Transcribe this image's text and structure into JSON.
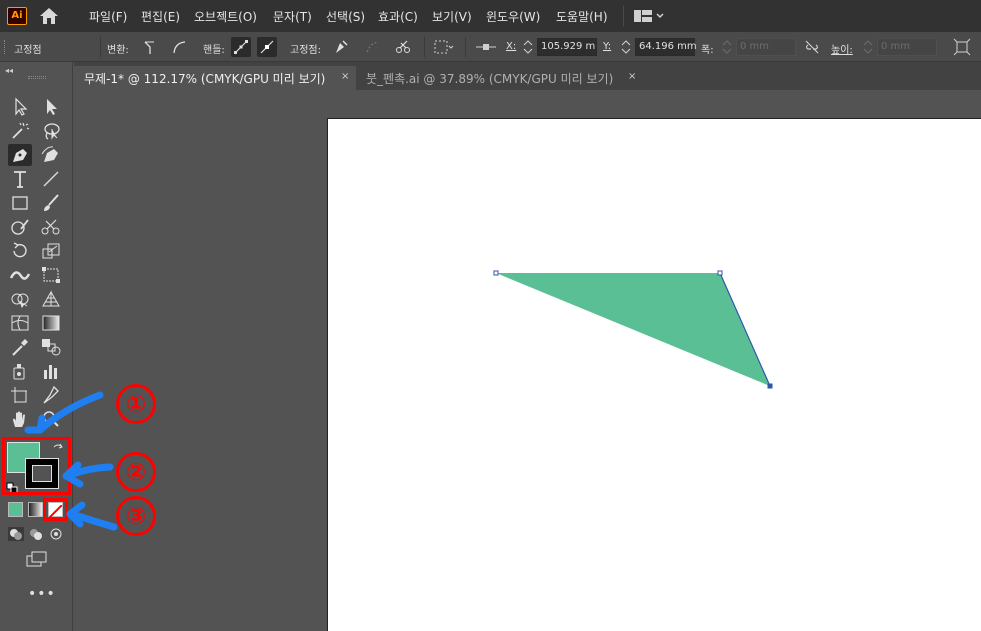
{
  "app": {
    "logo": "Ai"
  },
  "menu": {
    "items": [
      "파일(F)",
      "편집(E)",
      "오브젝트(O)",
      "문자(T)",
      "선택(S)",
      "효과(C)",
      "보기(V)",
      "윈도우(W)",
      "도움말(H)"
    ]
  },
  "control_bar": {
    "anchor_label": "고정점",
    "convert_label": "변환:",
    "handles_label": "핸들:",
    "anchors_label": "고정점:",
    "x_label": "X:",
    "x_value": "105.929 m",
    "y_label": "Y:",
    "y_value": "64.196 mm",
    "width_label": "폭:",
    "width_value": "0 mm",
    "height_label": "높이:",
    "height_value": "0 mm"
  },
  "tabs": [
    {
      "label": "무제-1* @ 112.17% (CMYK/GPU 미리 보기)",
      "close": "×",
      "active": true
    },
    {
      "label": "붓_펜촉.ai @ 37.89% (CMYK/GPU 미리 보기)",
      "close": "×",
      "active": false
    }
  ],
  "panel": {
    "collapse": "◂◂",
    "more": "•••"
  },
  "swatches": {
    "fill_color": "#5bbf96",
    "stroke_color": "#000000"
  },
  "shape": {
    "fill_color": "#5bbf96",
    "stroke_color": "#2f57a8"
  },
  "annotations": [
    {
      "label": "①"
    },
    {
      "label": "②"
    },
    {
      "label": "③"
    }
  ],
  "colors": {
    "annotation_red": "#ff0000",
    "annotation_arrow": "#1f7ff0",
    "accent_green": "#5bbf96"
  }
}
